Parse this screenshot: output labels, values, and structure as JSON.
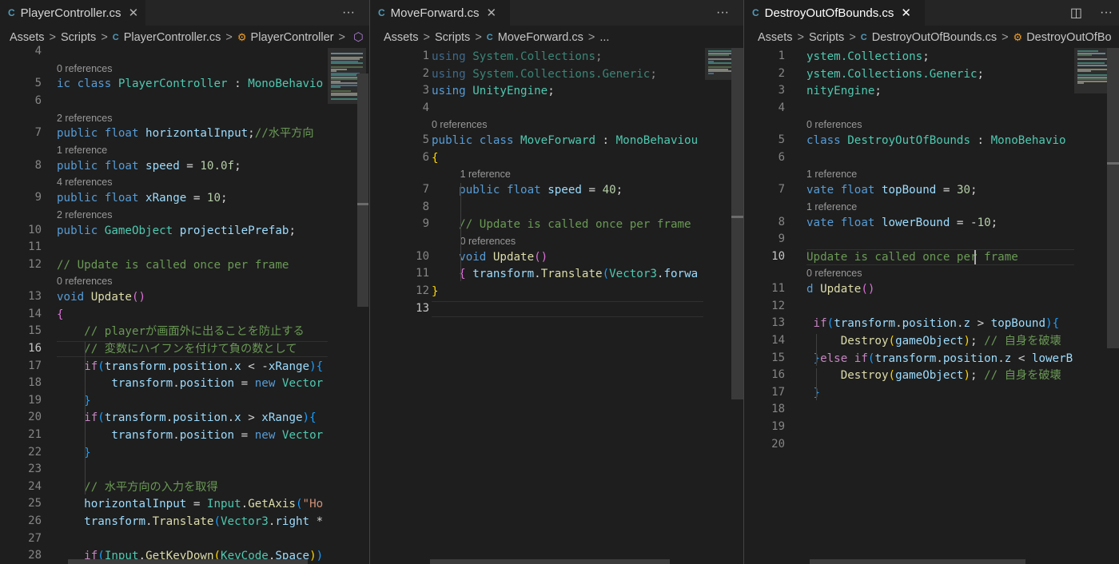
{
  "panes": [
    {
      "tab": {
        "icon": "C",
        "label": "PlayerController.cs",
        "close": "✕"
      },
      "actions": {
        "more": "···"
      },
      "breadcrumb": [
        "Assets",
        "Scripts",
        "PlayerController.cs",
        "PlayerController"
      ],
      "lines": [
        {
          "n": "4",
          "html": ""
        },
        {
          "ref": "0 references"
        },
        {
          "n": "5",
          "html": "<span class=\"kw\">ic class</span> <span class=\"ty\">PlayerController</span> : <span class=\"ty\">MonoBehavio</span>"
        },
        {
          "n": "6",
          "html": ""
        },
        {
          "ref": "2 references"
        },
        {
          "n": "7",
          "html": "<span class=\"kw\">public float</span> <span class=\"vr\">horizontalInput</span>;<span class=\"cm\">//水平方向</span>"
        },
        {
          "ref": "1 reference"
        },
        {
          "n": "8",
          "html": "<span class=\"kw\">public float</span> <span class=\"vr\">speed</span> = <span class=\"nm\">10.0f</span>;"
        },
        {
          "ref": "4 references"
        },
        {
          "n": "9",
          "html": "<span class=\"kw\">public float</span> <span class=\"vr\">xRange</span> = <span class=\"nm\">10</span>;"
        },
        {
          "ref": "2 references"
        },
        {
          "n": "10",
          "html": "<span class=\"kw\">public</span> <span class=\"ty\">GameObject</span> <span class=\"vr\">projectilePrefab</span>;"
        },
        {
          "n": "11",
          "html": ""
        },
        {
          "n": "12",
          "html": "<span class=\"cm\">// Update is called once per frame</span>"
        },
        {
          "ref": "0 references"
        },
        {
          "n": "13",
          "html": "<span class=\"kw\">void</span> <span class=\"fn\">Update</span><span class=\"br2\">()</span>"
        },
        {
          "n": "14",
          "html": "<span class=\"br2\">{</span>"
        },
        {
          "n": "15",
          "html": "    <span class=\"cm\">// playerが画面外に出ることを防止する</span>"
        },
        {
          "n": "16",
          "cur": true,
          "html": "    <span class=\"cm\">// 変数にハイフンを付けて負の数として</span>"
        },
        {
          "n": "17",
          "html": "    <span class=\"ctl\">if</span><span class=\"br3\">(</span><span class=\"vr\">transform</span>.<span class=\"vr\">position</span>.<span class=\"vr\">x</span> &lt; -<span class=\"vr\">xRange</span><span class=\"br3\">)</span><span class=\"br3\">{</span>"
        },
        {
          "n": "18",
          "html": "        <span class=\"vr\">transform</span>.<span class=\"vr\">position</span> = <span class=\"kw\">new</span> <span class=\"ty\">Vector</span>"
        },
        {
          "n": "19",
          "html": "    <span class=\"br3\">}</span>"
        },
        {
          "n": "20",
          "html": "    <span class=\"ctl\">if</span><span class=\"br3\">(</span><span class=\"vr\">transform</span>.<span class=\"vr\">position</span>.<span class=\"vr\">x</span> &gt; <span class=\"vr\">xRange</span><span class=\"br3\">)</span><span class=\"br3\">{</span>"
        },
        {
          "n": "21",
          "html": "        <span class=\"vr\">transform</span>.<span class=\"vr\">position</span> = <span class=\"kw\">new</span> <span class=\"ty\">Vector</span>"
        },
        {
          "n": "22",
          "html": "    <span class=\"br3\">}</span>"
        },
        {
          "n": "23",
          "html": ""
        },
        {
          "n": "24",
          "html": "    <span class=\"cm\">// 水平方向の入力を取得</span>"
        },
        {
          "n": "25",
          "html": "    <span class=\"vr\">horizontalInput</span> = <span class=\"ty\">Input</span>.<span class=\"fn\">GetAxis</span><span class=\"br3\">(</span><span class=\"st\">\"Ho</span>"
        },
        {
          "n": "26",
          "html": "    <span class=\"vr\">transform</span>.<span class=\"fn\">Translate</span><span class=\"br3\">(</span><span class=\"ty\">Vector3</span>.<span class=\"vr\">right</span> *"
        },
        {
          "n": "27",
          "html": ""
        },
        {
          "n": "28",
          "html": "    <span class=\"ctl\">if</span><span class=\"br3\">(</span><span class=\"ty\">Input</span>.<span class=\"fn\">GetKeyDown</span><span class=\"br1\">(</span><span class=\"ty\">KeyCode</span>.<span class=\"vr\">Space</span><span class=\"br1\">)</span><span class=\"br3\">)</span>"
        }
      ]
    },
    {
      "tab": {
        "icon": "C",
        "label": "MoveForward.cs",
        "close": "✕"
      },
      "actions": {
        "more": "···"
      },
      "breadcrumb": [
        "Assets",
        "Scripts",
        "MoveForward.cs",
        "..."
      ],
      "lines": [
        {
          "n": "1",
          "html": "<span class=\"kw\">using</span> <span class=\"ty\">System.Collections</span>;",
          "dim": true
        },
        {
          "n": "2",
          "html": "<span class=\"kw\">using</span> <span class=\"ty\">System.Collections.Generic</span>;",
          "dim": true
        },
        {
          "n": "3",
          "html": "<span class=\"kw\">using</span> <span class=\"ty\">UnityEngine</span>;"
        },
        {
          "n": "4",
          "html": ""
        },
        {
          "ref": "0 references"
        },
        {
          "n": "5",
          "html": "<span class=\"kw\">public class</span> <span class=\"ty\">MoveForward</span> : <span class=\"ty\">MonoBehaviou</span>"
        },
        {
          "n": "6",
          "html": "<span class=\"br1\">{</span>"
        },
        {
          "ref": "1 reference",
          "indent": 4
        },
        {
          "n": "7",
          "html": "    <span class=\"kw\">public float</span> <span class=\"vr\">speed</span> = <span class=\"nm\">40</span>;"
        },
        {
          "n": "8",
          "html": ""
        },
        {
          "n": "9",
          "html": "    <span class=\"cm\">// Update is called once per frame</span>"
        },
        {
          "ref": "0 references",
          "indent": 4
        },
        {
          "n": "10",
          "html": "    <span class=\"kw\">void</span> <span class=\"fn\">Update</span><span class=\"br2\">()</span>"
        },
        {
          "n": "11",
          "html": "    <span class=\"br2\">{</span> <span class=\"vr\">transform</span>.<span class=\"fn\">Translate</span><span class=\"br3\">(</span><span class=\"ty\">Vector3</span>.<span class=\"vr\">forwa</span>"
        },
        {
          "n": "12",
          "html": "<span class=\"br1\">}</span>"
        },
        {
          "n": "13",
          "cur": true,
          "html": ""
        }
      ]
    },
    {
      "tab": {
        "icon": "C",
        "label": "DestroyOutOfBounds.cs",
        "close": "✕"
      },
      "actions": {
        "split": "◫",
        "more": "···"
      },
      "breadcrumb": [
        "Assets",
        "Scripts",
        "DestroyOutOfBounds.cs",
        "DestroyOutOfBo"
      ],
      "lines": [
        {
          "n": "1",
          "html": "<span class=\"ty\">ystem.Collections</span>;"
        },
        {
          "n": "2",
          "html": "<span class=\"ty\">ystem.Collections.Generic</span>;"
        },
        {
          "n": "3",
          "html": "<span class=\"ty\">nityEngine</span>;"
        },
        {
          "n": "4",
          "html": ""
        },
        {
          "ref": "0 references"
        },
        {
          "n": "5",
          "html": "<span class=\"kw\">class</span> <span class=\"ty\">DestroyOutOfBounds</span> : <span class=\"ty\">MonoBehavio</span>"
        },
        {
          "n": "6",
          "html": ""
        },
        {
          "ref": "1 reference"
        },
        {
          "n": "7",
          "html": "<span class=\"kw\">vate float</span> <span class=\"vr\">topBound</span> = <span class=\"nm\">30</span>;"
        },
        {
          "ref": "1 reference"
        },
        {
          "n": "8",
          "html": "<span class=\"kw\">vate float</span> <span class=\"vr\">lowerBound</span> = -<span class=\"nm\">10</span>;"
        },
        {
          "n": "9",
          "html": ""
        },
        {
          "n": "10",
          "cur": true,
          "html": "<span class=\"cm\">Update is called once per frame</span>"
        },
        {
          "ref": "0 references"
        },
        {
          "n": "11",
          "html": "<span class=\"kw\">d</span> <span class=\"fn\">Update</span><span class=\"br2\">()</span>"
        },
        {
          "n": "12",
          "html": ""
        },
        {
          "n": "13",
          "html": " <span class=\"ctl\">if</span><span class=\"br3\">(</span><span class=\"vr\">transform</span>.<span class=\"vr\">position</span>.<span class=\"vr\">z</span> &gt; <span class=\"vr\">topBound</span><span class=\"br3\">)</span><span class=\"br3\">{</span>"
        },
        {
          "n": "14",
          "html": "     <span class=\"fn\">Destroy</span><span class=\"br1\">(</span><span class=\"vr\">gameObject</span><span class=\"br1\">)</span>; <span class=\"cm\">// 自身を破壊</span>"
        },
        {
          "n": "15",
          "html": " <span class=\"br3\">}</span><span class=\"ctl\">else if</span><span class=\"br3\">(</span><span class=\"vr\">transform</span>.<span class=\"vr\">position</span>.<span class=\"vr\">z</span> &lt; <span class=\"vr\">lowerB</span>"
        },
        {
          "n": "16",
          "html": "     <span class=\"fn\">Destroy</span><span class=\"br1\">(</span><span class=\"vr\">gameObject</span><span class=\"br1\">)</span>; <span class=\"cm\">// 自身を破壊</span>"
        },
        {
          "n": "17",
          "html": " <span class=\"br3\">}</span>"
        },
        {
          "n": "18",
          "html": ""
        },
        {
          "n": "19",
          "html": ""
        },
        {
          "n": "20",
          "html": ""
        }
      ]
    }
  ]
}
